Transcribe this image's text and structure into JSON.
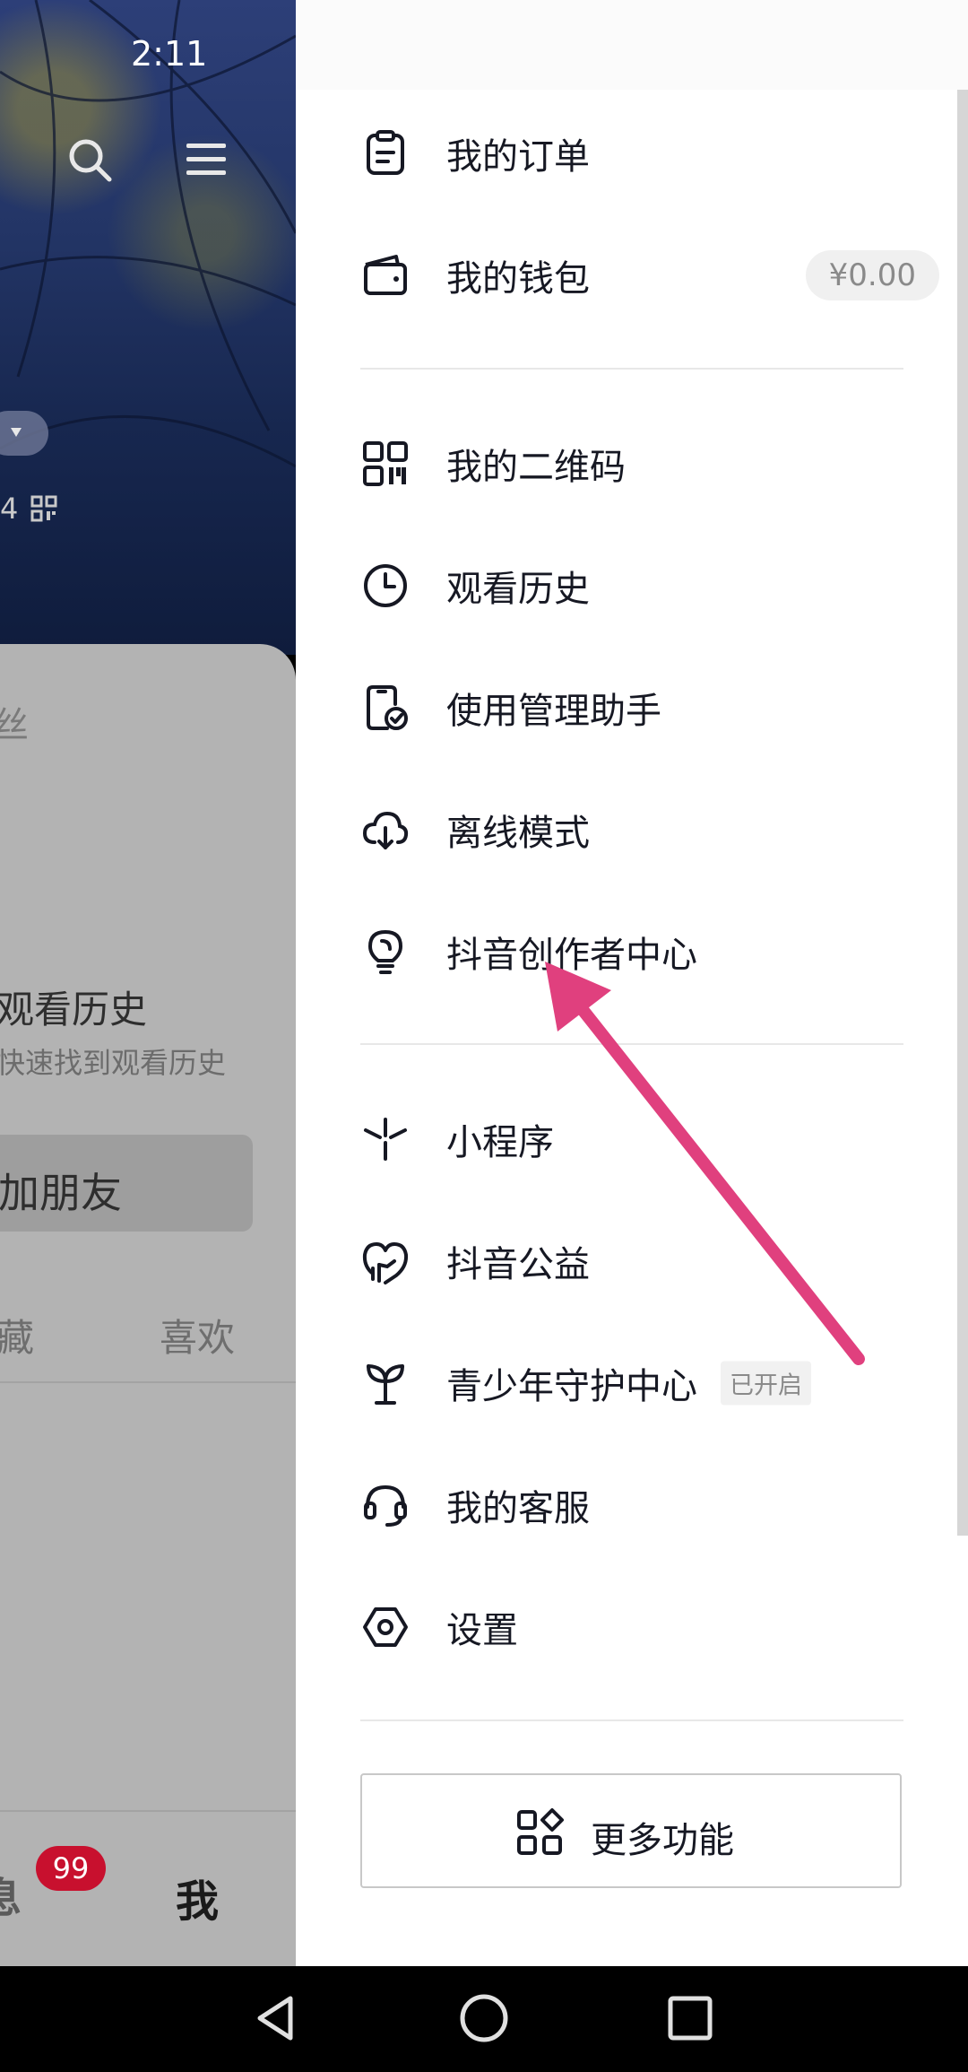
{
  "status_bar": {
    "time": "2:11"
  },
  "background": {
    "count_text": "4",
    "fans_fragment": "丝",
    "history_card_title": "观看历史",
    "history_card_subtitle": "快速找到观看历史",
    "add_friend_button": "加朋友",
    "tabs": [
      "藏",
      "喜欢"
    ],
    "bottom_nav": {
      "messages_fragment": "息",
      "messages_badge": "99",
      "me": "我"
    }
  },
  "drawer": {
    "section1": [
      {
        "label": "我的订单",
        "icon": "order-icon"
      },
      {
        "label": "我的钱包",
        "icon": "wallet-icon",
        "value": "¥0.00"
      }
    ],
    "section2": [
      {
        "label": "我的二维码",
        "icon": "qr-code-icon"
      },
      {
        "label": "观看历史",
        "icon": "clock-icon"
      },
      {
        "label": "使用管理助手",
        "icon": "phone-check-icon"
      },
      {
        "label": "离线模式",
        "icon": "cloud-download-icon"
      },
      {
        "label": "抖音创作者中心",
        "icon": "lightbulb-icon"
      }
    ],
    "section3": [
      {
        "label": "小程序",
        "icon": "mini-program-icon"
      },
      {
        "label": "抖音公益",
        "icon": "charity-heart-icon"
      },
      {
        "label": "青少年守护中心",
        "icon": "sprout-icon",
        "badge": "已开启"
      },
      {
        "label": "我的客服",
        "icon": "headset-icon"
      },
      {
        "label": "设置",
        "icon": "settings-hex-icon"
      }
    ],
    "more_button": "更多功能"
  },
  "colors": {
    "annotation_arrow": "#e0407e",
    "badge_red": "#c8102e",
    "text": "#161823"
  }
}
